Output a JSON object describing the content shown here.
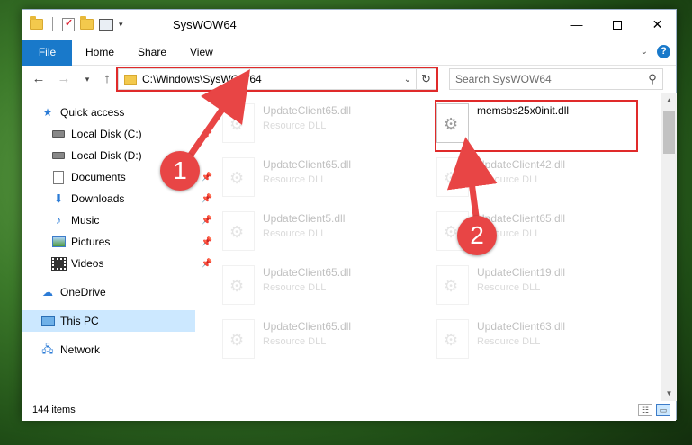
{
  "window": {
    "title": "SysWOW64"
  },
  "ribbon": {
    "tabs": [
      "File",
      "Home",
      "Share",
      "View"
    ]
  },
  "nav": {
    "address": "C:\\Windows\\SysWOW64",
    "search_placeholder": "Search SysWOW64"
  },
  "sidebar": {
    "items": [
      {
        "label": "Quick access",
        "icon": "star-icon",
        "pinned": false
      },
      {
        "label": "Local Disk (C:)",
        "icon": "drive-icon",
        "pinned": true
      },
      {
        "label": "Local Disk (D:)",
        "icon": "drive-icon",
        "pinned": false
      },
      {
        "label": "Documents",
        "icon": "documents-icon",
        "pinned": true
      },
      {
        "label": "Downloads",
        "icon": "downloads-icon",
        "pinned": true
      },
      {
        "label": "Music",
        "icon": "music-icon",
        "pinned": true
      },
      {
        "label": "Pictures",
        "icon": "pictures-icon",
        "pinned": true
      },
      {
        "label": "Videos",
        "icon": "videos-icon",
        "pinned": true
      },
      {
        "label": "OneDrive",
        "icon": "onedrive-icon",
        "pinned": false
      },
      {
        "label": "This PC",
        "icon": "pc-icon",
        "pinned": false,
        "selected": true
      },
      {
        "label": "Network",
        "icon": "network-icon",
        "pinned": false
      }
    ]
  },
  "files": [
    {
      "name": "UpdateClient65.dll",
      "type": "Resource DLL",
      "faded": true
    },
    {
      "name": "memsbs25x0init.dll",
      "type": "",
      "faded": false
    },
    {
      "name": "UpdateClient65.dll",
      "type": "Resource DLL",
      "faded": true
    },
    {
      "name": "UpdateClient42.dll",
      "type": "Resource DLL",
      "faded": true
    },
    {
      "name": "UpdateClient5.dll",
      "type": "Resource DLL",
      "faded": true
    },
    {
      "name": "UpdateClient65.dll",
      "type": "Resource DLL",
      "faded": true
    },
    {
      "name": "UpdateClient65.dll",
      "type": "Resource DLL",
      "faded": true
    },
    {
      "name": "UpdateClient19.dll",
      "type": "Resource DLL",
      "faded": true
    },
    {
      "name": "UpdateClient65.dll",
      "type": "Resource DLL",
      "faded": true
    },
    {
      "name": "UpdateClient63.dll",
      "type": "Resource DLL",
      "faded": true
    }
  ],
  "status": {
    "count": "144 items"
  },
  "annotations": {
    "step1": "1",
    "step2": "2",
    "color": "#e02a2a"
  }
}
